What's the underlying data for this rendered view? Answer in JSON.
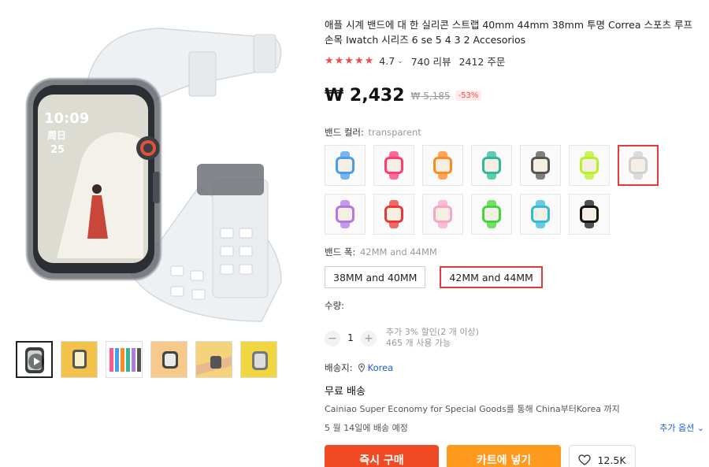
{
  "product": {
    "title": "애플 시계 밴드에 대 한 실리콘 스트랩 40mm 44mm 38mm 투명 Correa 스포츠 루프 손목 Iwatch 시리즈 6 se 5 4 3 2 Accesorios",
    "stars": "★★★★★",
    "rating": "4.7",
    "reviews": "740 리뷰",
    "orders": "2412 주문"
  },
  "price": {
    "current": "₩ 2,432",
    "original": "₩ 5,185",
    "discount": "-53%"
  },
  "color": {
    "label": "밴드 컬러:",
    "selected": "transparent",
    "swatch_colors": [
      "#4a9ee8",
      "#ff3b7a",
      "#ff8a1e",
      "#2fb89a",
      "#555555",
      "#b8ef2a",
      "#d0d0d0",
      "#b07ae0",
      "#e83a3a",
      "#f5a6c6",
      "#43d63a",
      "#35b9d6",
      "#151515"
    ],
    "selected_index": 6
  },
  "width": {
    "label": "밴드 폭:",
    "selected": "42MM and 44MM",
    "options": [
      "38MM and 40MM",
      "42MM and 44MM"
    ]
  },
  "quantity": {
    "label": "수량:",
    "minus": "−",
    "value": "1",
    "plus": "+",
    "note_discount": "추가 3% 할인(2 개 이상)",
    "note_available": "465 개 사용 가능"
  },
  "shipping": {
    "ship_to_label": "배송지:",
    "location": "Korea",
    "free": "무료 배송",
    "description": "Cainiao Super Economy for Special Goods를 통해 China부터Korea 까지",
    "eta": "5 월 14일에 배송 예정",
    "more": "추가 옵션"
  },
  "actions": {
    "buy": "즉시 구매",
    "cart": "카트에 넣기",
    "wishlist_count": "12.5K"
  },
  "watch_face": {
    "time": "10:09",
    "day": "周日",
    "date": "25"
  },
  "colors": {
    "accent_red": "#e23b3b",
    "buy": "#f04a24",
    "cart": "#ff9a1e",
    "link": "#1a5ed4"
  }
}
